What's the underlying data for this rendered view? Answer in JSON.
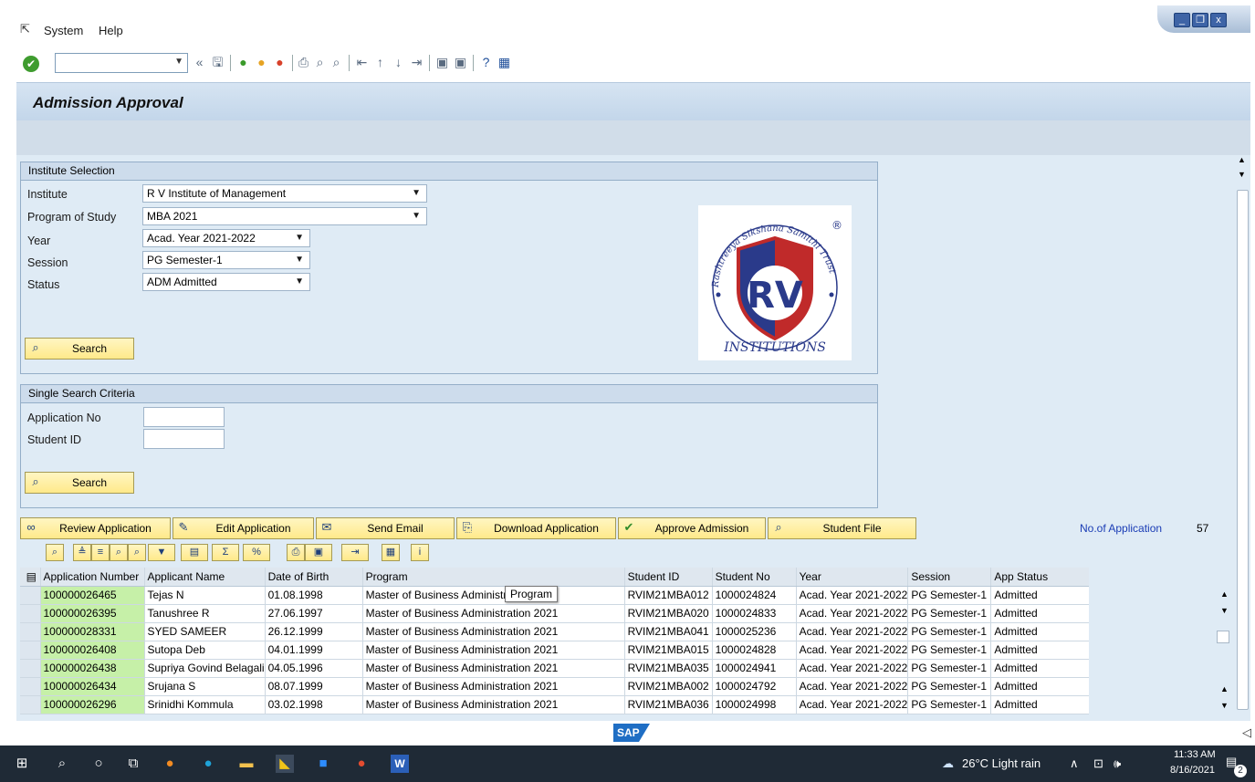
{
  "menu": {
    "system": "System",
    "help": "Help"
  },
  "window_controls": {
    "minimize": "_",
    "restore": "❐",
    "close": "x"
  },
  "toolbar": {
    "command_value": ""
  },
  "screen_title": "Admission Approval",
  "institute_selection": {
    "header": "Institute Selection",
    "fields": [
      {
        "label": "Institute",
        "value": "R V Institute of Management"
      },
      {
        "label": "Program of Study",
        "value": "MBA 2021"
      },
      {
        "label": "Year",
        "value": "Acad. Year 2021-2022"
      },
      {
        "label": "Session",
        "value": "PG Semester-1"
      },
      {
        "label": "Status",
        "value": "ADM Admitted"
      }
    ],
    "search_label": "Search"
  },
  "logo": {
    "arc_text": "Rashtreeya Sikshana Samithi Trust",
    "letters": "RV",
    "bottom_text": "INSTITUTIONS",
    "registered": "®"
  },
  "single_search": {
    "header": "Single Search Criteria",
    "application_no_label": "Application No",
    "application_no_value": "",
    "student_id_label": "Student ID",
    "student_id_value": "",
    "search_label": "Search"
  },
  "actions": [
    {
      "label": "Review Application",
      "icon": "glasses-icon"
    },
    {
      "label": "Edit Application",
      "icon": "pencil-icon"
    },
    {
      "label": "Send Email",
      "icon": "email-icon"
    },
    {
      "label": "Download Application",
      "icon": "download-icon"
    },
    {
      "label": "Approve Admission",
      "icon": "checkmark-icon"
    },
    {
      "label": "Student File",
      "icon": "magnify-icon"
    }
  ],
  "application_count": {
    "label": "No.of Application",
    "value": "57"
  },
  "tooltip": "Program",
  "grid": {
    "columns": [
      "Application Number",
      "Applicant Name",
      "Date of Birth",
      "Program",
      "Student ID",
      "Student No",
      "Year",
      "Session",
      "App Status"
    ],
    "rows": [
      [
        "100000026465",
        "Tejas N",
        "01.08.1998",
        "Master of Business Administration 2021",
        "RVIM21MBA012",
        "1000024824",
        "Acad. Year 2021-2022",
        "PG Semester-1",
        "Admitted"
      ],
      [
        "100000026395",
        "Tanushree R",
        "27.06.1997",
        "Master of Business Administration 2021",
        "RVIM21MBA020",
        "1000024833",
        "Acad. Year 2021-2022",
        "PG Semester-1",
        "Admitted"
      ],
      [
        "100000028331",
        "SYED SAMEER",
        "26.12.1999",
        "Master of Business Administration 2021",
        "RVIM21MBA041",
        "1000025236",
        "Acad. Year 2021-2022",
        "PG Semester-1",
        "Admitted"
      ],
      [
        "100000026408",
        "Sutopa Deb",
        "04.01.1999",
        "Master of Business Administration 2021",
        "RVIM21MBA015",
        "1000024828",
        "Acad. Year 2021-2022",
        "PG Semester-1",
        "Admitted"
      ],
      [
        "100000026438",
        "Supriya Govind Belagali",
        "04.05.1996",
        "Master of Business Administration 2021",
        "RVIM21MBA035",
        "1000024941",
        "Acad. Year 2021-2022",
        "PG Semester-1",
        "Admitted"
      ],
      [
        "100000026434",
        "Srujana S",
        "08.07.1999",
        "Master of Business Administration 2021",
        "RVIM21MBA002",
        "1000024792",
        "Acad. Year 2021-2022",
        "PG Semester-1",
        "Admitted"
      ],
      [
        "100000026296",
        "Srinidhi Kommula",
        "03.02.1998",
        "Master of Business Administration 2021",
        "RVIM21MBA036",
        "1000024998",
        "Acad. Year 2021-2022",
        "PG Semester-1",
        "Admitted"
      ]
    ]
  },
  "sap_logo": "SAP",
  "taskbar": {
    "weather": "26°C  Light rain",
    "time": "11:33 AM",
    "date": "8/16/2021",
    "notifications": "2"
  },
  "colors": {
    "sap_blue": "#1f6ec4",
    "key_green": "#c6f0a8",
    "button_yellow": "#ffe98a",
    "count_blue": "#1a3cb5"
  }
}
